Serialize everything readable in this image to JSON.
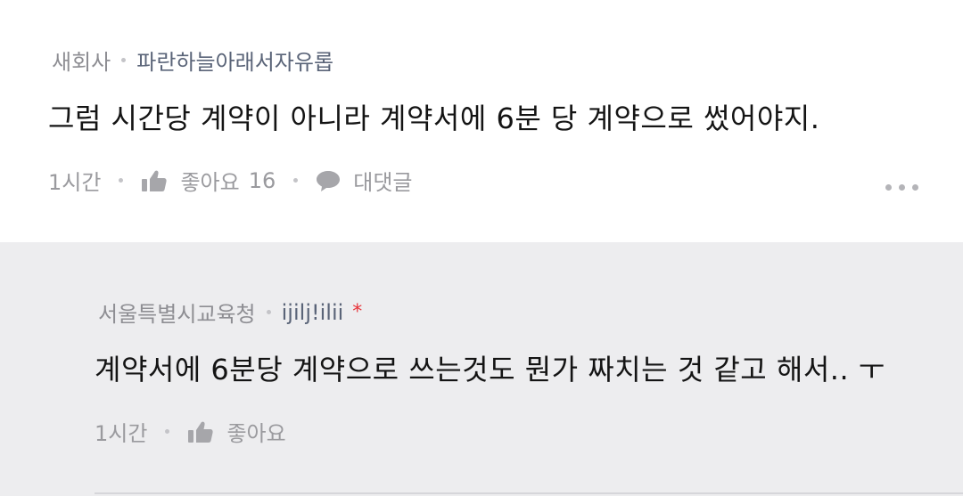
{
  "comment": {
    "author": "새회사",
    "group": "파란하늘아래서자유롭",
    "text": "그럼 시간당 계약이 아니라 계약서에 6분 당 계약으로 썼어야지.",
    "time": "1시간",
    "like_label": "좋아요",
    "like_count": "16",
    "reply_label": "대댓글",
    "more_icon": "more-horizontal-icon"
  },
  "reply": {
    "author": "서울특별시교육청",
    "group": "ijilj!ilii",
    "star": "*",
    "text": "계약서에 6분당 계약으로 쓰는것도 뭔가 짜치는 것 같고 해서.. ㅜ",
    "time": "1시간",
    "like_label": "좋아요"
  },
  "icons": {
    "like": "thumbs-up-icon",
    "reply": "speech-bubble-icon"
  },
  "colors": {
    "reply_background": "#ededef",
    "star": "#e8343a",
    "text": "#141414",
    "muted": "#9a9a9e"
  }
}
